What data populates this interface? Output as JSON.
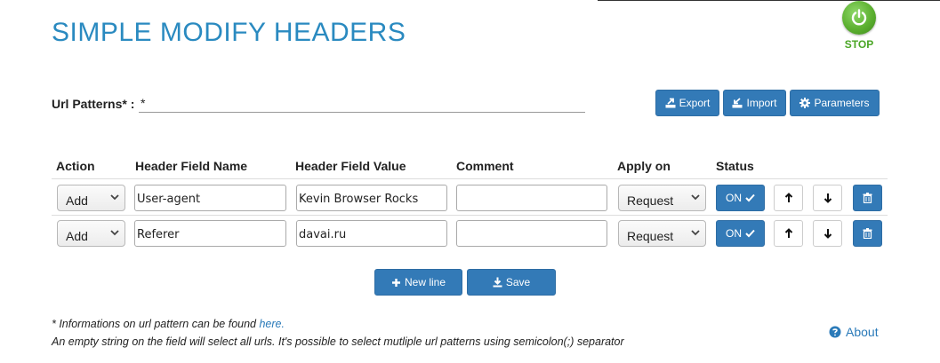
{
  "app": {
    "title": "SIMPLE MODIFY HEADERS"
  },
  "stop": {
    "label": "STOP"
  },
  "url": {
    "label": "Url Patterns* :",
    "value": "*"
  },
  "toolbar": {
    "export": "Export",
    "import": "Import",
    "parameters": "Parameters"
  },
  "table": {
    "headers": [
      "Action",
      "Header Field Name",
      "Header Field Value",
      "Comment",
      "Apply on",
      "Status"
    ],
    "rows": [
      {
        "action": "Add",
        "name": "User-agent",
        "value": "Kevin Browser Rocks",
        "comment": "",
        "apply_on": "Request",
        "status": "ON"
      },
      {
        "action": "Add",
        "name": "Referer",
        "value": "davai.ru",
        "comment": "",
        "apply_on": "Request",
        "status": "ON"
      }
    ]
  },
  "actions": {
    "new_line": "New line",
    "save": "Save"
  },
  "notes": {
    "line1_prefix": "* Informations on url pattern can be found ",
    "line1_link": "here.",
    "line2": "An empty string on the field will select all urls. It's possible to select mutliple url patterns using semicolon(;) separator"
  },
  "about": {
    "label": "About"
  },
  "colors": {
    "primary": "#337ab7",
    "title": "#2a8ac0",
    "stop_green": "#5cb030"
  },
  "icons": [
    "power-icon",
    "export-icon",
    "import-icon",
    "gear-icon",
    "checkmark-icon",
    "arrow-up-icon",
    "arrow-down-icon",
    "trash-icon",
    "plus-icon",
    "download-icon",
    "question-circle-icon",
    "chevron-down-icon"
  ]
}
